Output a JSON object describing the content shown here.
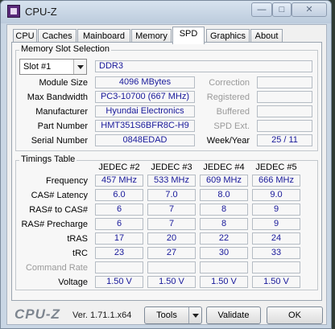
{
  "window": {
    "title": "CPU-Z",
    "min_label": "—",
    "max_label": "□",
    "close_label": "✕"
  },
  "tabs": [
    "CPU",
    "Caches",
    "Mainboard",
    "Memory",
    "SPD",
    "Graphics",
    "About"
  ],
  "active_tab": "SPD",
  "memory_slot": {
    "legend": "Memory Slot Selection",
    "slot_value": "Slot #1",
    "type": "DDR3",
    "labels": {
      "module_size": "Module Size",
      "max_bandwidth": "Max Bandwidth",
      "manufacturer": "Manufacturer",
      "part_number": "Part Number",
      "serial_number": "Serial Number",
      "correction": "Correction",
      "registered": "Registered",
      "buffered": "Buffered",
      "spd_ext": "SPD Ext.",
      "week_year": "Week/Year"
    },
    "values": {
      "module_size": "4096 MBytes",
      "max_bandwidth": "PC3-10700 (667 MHz)",
      "manufacturer": "Hyundai Electronics",
      "part_number": "HMT351S6BFR8C-H9",
      "serial_number": "0848EDAD",
      "week_year": "25 / 11"
    }
  },
  "timings": {
    "legend": "Timings Table",
    "columns": [
      "JEDEC #2",
      "JEDEC #3",
      "JEDEC #4",
      "JEDEC #5"
    ],
    "rows": [
      {
        "label": "Frequency",
        "values": [
          "457 MHz",
          "533 MHz",
          "609 MHz",
          "666 MHz"
        ]
      },
      {
        "label": "CAS# Latency",
        "values": [
          "6.0",
          "7.0",
          "8.0",
          "9.0"
        ]
      },
      {
        "label": "RAS# to CAS#",
        "values": [
          "6",
          "7",
          "8",
          "9"
        ]
      },
      {
        "label": "RAS# Precharge",
        "values": [
          "6",
          "7",
          "8",
          "9"
        ]
      },
      {
        "label": "tRAS",
        "values": [
          "17",
          "20",
          "22",
          "24"
        ]
      },
      {
        "label": "tRC",
        "values": [
          "23",
          "27",
          "30",
          "33"
        ]
      },
      {
        "label": "Command Rate",
        "values": [
          "",
          "",
          "",
          ""
        ]
      },
      {
        "label": "Voltage",
        "values": [
          "1.50 V",
          "1.50 V",
          "1.50 V",
          "1.50 V"
        ]
      }
    ]
  },
  "footer": {
    "logo": "CPU-Z",
    "version": "Ver. 1.71.1.x64",
    "tools_label": "Tools",
    "validate_label": "Validate",
    "ok_label": "OK"
  }
}
